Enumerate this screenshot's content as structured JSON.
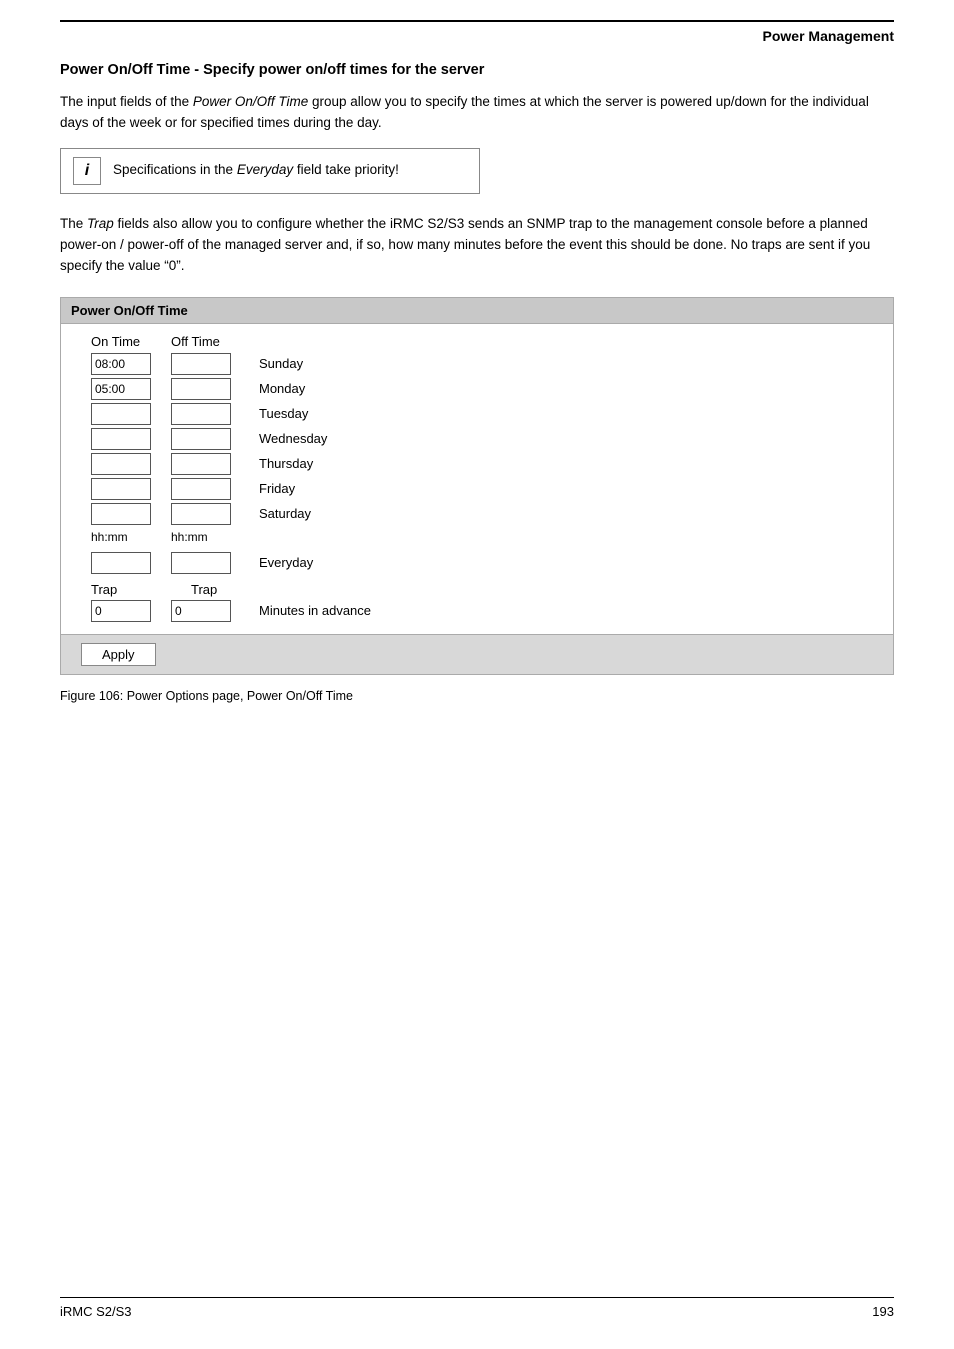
{
  "header": {
    "title": "Power Management"
  },
  "section": {
    "title": "Power On/Off Time - Specify power on/off times for the server",
    "intro_text": "The input fields of the Power On/Off Time group allow you to specify the times at which the server is powered up/down for the individual days of the week or for specified times during the day.",
    "intro_italic": "Power On/Off Time",
    "info_text_pre": "Specifications in the ",
    "info_italic": "Everyday",
    "info_text_post": " field take priority!",
    "body_text_pre": "The ",
    "body_trap_italic": "Trap",
    "body_text": " fields also allow you to configure whether the iRMC S2/S3 sends an SNMP trap to the management console before a planned power-on / power-off of the managed server and, if so, how many minutes before the event this should be done. No traps are sent if you specify the value “0”."
  },
  "power_table": {
    "header": "Power On/Off Time",
    "col_on": "On Time",
    "col_off": "Off Time",
    "days": [
      {
        "on_value": "08:00",
        "off_value": "",
        "label": "Sunday"
      },
      {
        "on_value": "05:00",
        "off_value": "",
        "label": "Monday"
      },
      {
        "on_value": "",
        "off_value": "",
        "label": "Tuesday"
      },
      {
        "on_value": "",
        "off_value": "",
        "label": "Wednesday"
      },
      {
        "on_value": "",
        "off_value": "",
        "label": "Thursday"
      },
      {
        "on_value": "",
        "off_value": "",
        "label": "Friday"
      },
      {
        "on_value": "",
        "off_value": "",
        "label": "Saturday"
      }
    ],
    "format_label_on": "hh:mm",
    "format_label_off": "hh:mm",
    "everyday_label": "Everyday",
    "everyday_on": "",
    "everyday_off": "",
    "trap_on_label": "Trap",
    "trap_off_label": "Trap",
    "trap_on_value": "0",
    "trap_off_value": "0",
    "minutes_label": "Minutes in advance",
    "apply_button": "Apply"
  },
  "figure_caption": "Figure 106: Power Options page, Power On/Off Time",
  "footer": {
    "left": "iRMC S2/S3",
    "right": "193"
  }
}
